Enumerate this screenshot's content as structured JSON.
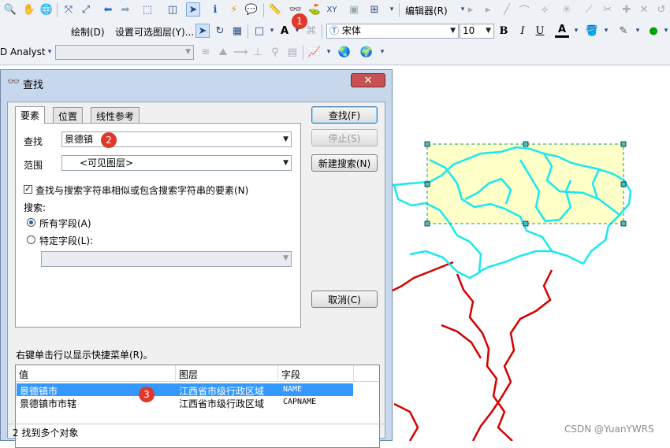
{
  "toolbar": {
    "editor_menu": "编辑器(R)",
    "draw_menu": "绘制(D)",
    "selectable_layers": "设置可选图层(Y)...",
    "font_name": "宋体",
    "font_size": "10",
    "bold": "B",
    "italic": "I",
    "underline": "U",
    "font_color_glyph": "A",
    "text_glyph": "A",
    "analyst_menu": "D Analyst",
    "cluster_label": "编辑"
  },
  "dialog": {
    "title": "查找",
    "tabs": [
      "要素",
      "位置",
      "线性参考"
    ],
    "find_label": "查找",
    "find_value": "景德镇",
    "scope_label": "范围",
    "scope_value": "<可见图层>",
    "similar_checkbox_label": "查找与搜索字符串相似或包含搜索字符串的要素(N)",
    "search_label": "搜索:",
    "all_fields_label": "所有字段(A)",
    "specific_field_label": "特定字段(L):",
    "buttons": {
      "find": "查找(F)",
      "stop": "停止(S)",
      "new_search": "新建搜索(N)",
      "cancel": "取消(C)"
    },
    "hint": "右键单击行以显示快捷菜单(R)。",
    "columns": [
      "值",
      "图层",
      "字段"
    ],
    "rows": [
      {
        "value": "景德镇市",
        "layer": "江西省市级行政区域",
        "field": "NAME"
      },
      {
        "value": "景德镇市市辖",
        "layer": "江西省市级行政区域",
        "field": "CAPNAME"
      }
    ],
    "status": "2 找到多个对象"
  },
  "annotations": [
    "1",
    "2",
    "3"
  ],
  "watermark": "CSDN @YuanYWRS",
  "colors": {
    "selection_fill": "#ffffc8",
    "selected_boundary": "#18e8f0",
    "other_boundary": "#d40000",
    "row_highlight": "#3399ff",
    "badge": "#e0392b"
  }
}
